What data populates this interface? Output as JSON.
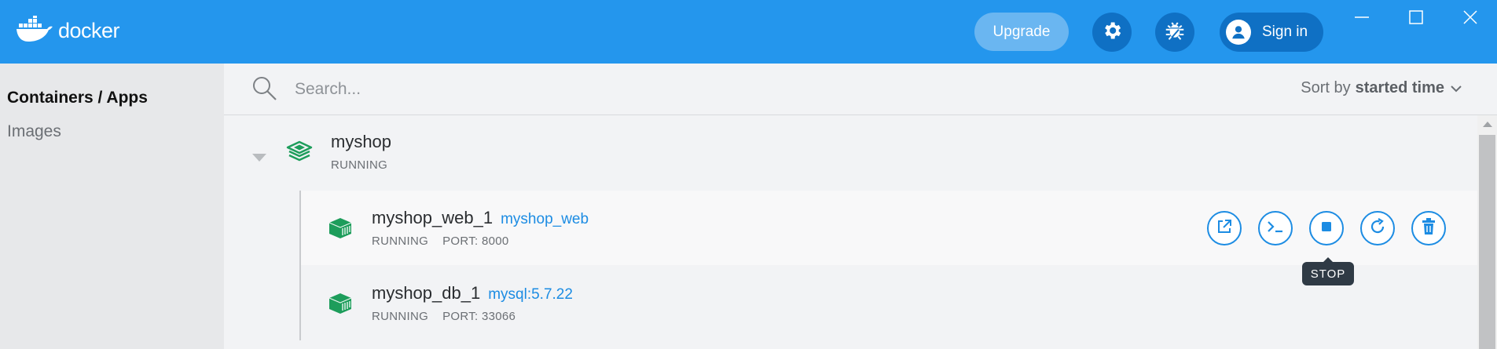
{
  "app": {
    "logo_text": "docker"
  },
  "header": {
    "upgrade_label": "Upgrade",
    "signin_label": "Sign in"
  },
  "sidebar": {
    "items": [
      {
        "label": "Containers / Apps",
        "active": true
      },
      {
        "label": "Images",
        "active": false
      }
    ]
  },
  "search": {
    "placeholder": "Search..."
  },
  "sort": {
    "prefix": "Sort by",
    "value": "started time"
  },
  "app_group": {
    "name": "myshop",
    "status": "RUNNING"
  },
  "containers": [
    {
      "name": "myshop_web_1",
      "image": "myshop_web",
      "status": "RUNNING",
      "port": "PORT: 8000"
    },
    {
      "name": "myshop_db_1",
      "image": "mysql:5.7.22",
      "status": "RUNNING",
      "port": "PORT: 33066"
    }
  ],
  "tooltip": {
    "text": "STOP"
  },
  "colors": {
    "brand": "#2496ed",
    "dark_button": "#0f70c4",
    "accent": "#1c8ce3",
    "container_green": "#1d9d5b"
  },
  "icons": [
    "docker-whale-icon",
    "gear-icon",
    "bug-icon",
    "user-icon",
    "minimize-icon",
    "maximize-icon",
    "close-icon",
    "search-icon",
    "chevron-down-icon",
    "stack-icon",
    "container-icon",
    "open-browser-icon",
    "cli-icon",
    "stop-icon",
    "restart-icon",
    "trash-icon"
  ]
}
